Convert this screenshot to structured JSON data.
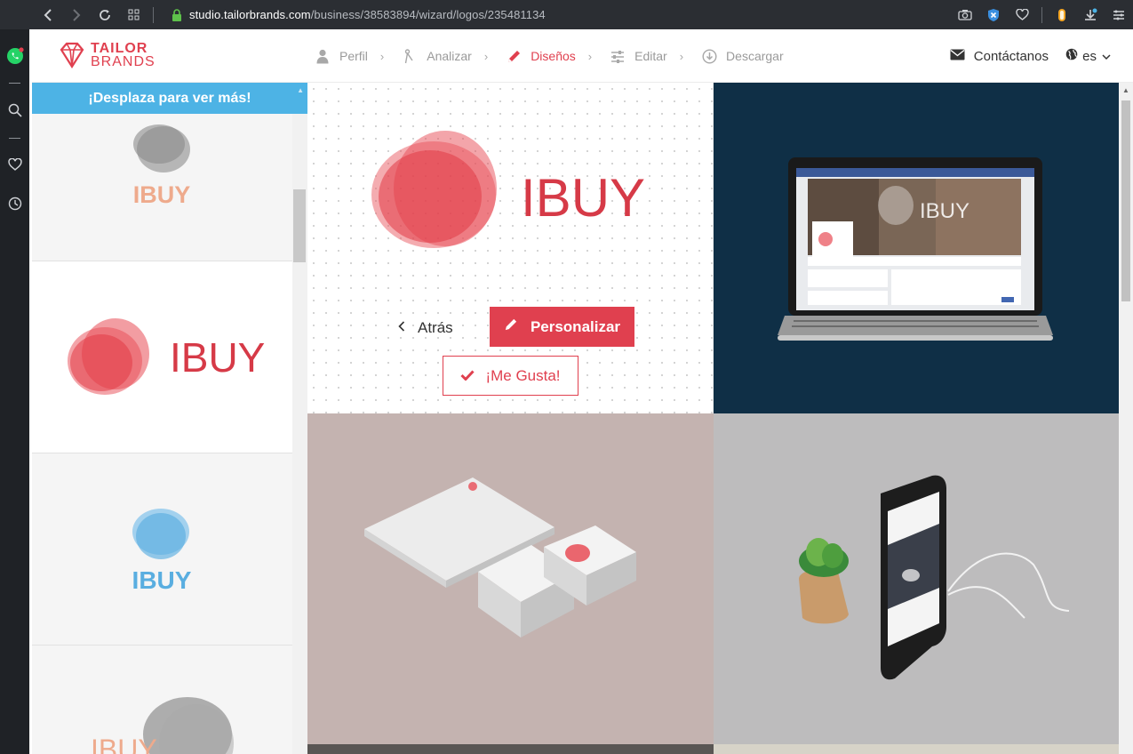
{
  "browser": {
    "url_host": "studio.tailorbrands.com",
    "url_path": "/business/38583894/wizard/logos/235481134"
  },
  "header": {
    "brand_line1": "TAILOR",
    "brand_line2": "BRANDS",
    "steps": [
      {
        "label": "Perfil",
        "icon": "user-icon",
        "active": false
      },
      {
        "label": "Analizar",
        "icon": "compass-icon",
        "active": false
      },
      {
        "label": "Diseños",
        "icon": "pencil-icon",
        "active": true
      },
      {
        "label": "Editar",
        "icon": "sliders-icon",
        "active": false
      },
      {
        "label": "Descargar",
        "icon": "download-icon",
        "active": false
      }
    ],
    "contact_label": "Contáctanos",
    "lang_label": "es"
  },
  "sidebar": {
    "scroll_hint": "¡Desplaza para ver más!",
    "logo_text": "IBUY"
  },
  "main": {
    "brand_name": "IBUY",
    "back_label": "Atrás",
    "customize_label": "Personalizar",
    "like_label": "¡Me Gusta!",
    "laptop_logo_text": "IBUY"
  },
  "colors": {
    "brand_red": "#e0404f",
    "banner_blue": "#4db3e5",
    "logo_blue": "#5aaee0",
    "logo_peach": "#eeaa8c"
  }
}
